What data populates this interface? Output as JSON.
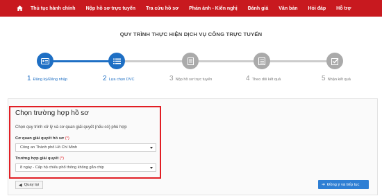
{
  "nav": {
    "items": [
      {
        "label": "Thủ tục hành chính"
      },
      {
        "label": "Nộp hồ sơ trực tuyến"
      },
      {
        "label": "Tra cứu hồ sơ"
      },
      {
        "label": "Phản ánh - Kiến nghị"
      },
      {
        "label": "Đánh giá"
      },
      {
        "label": "Văn bản"
      },
      {
        "label": "Hỏi đáp"
      },
      {
        "label": "Hỗ trợ"
      }
    ],
    "home_icon": "home-icon"
  },
  "page_title": "QUY TRÌNH THỰC HIỆN DỊCH VỤ CÔNG TRỰC TUYẾN",
  "steps": [
    {
      "num": "1",
      "label": "Đăng ký/Đăng nhập",
      "icon": "id-card-icon",
      "state": "done"
    },
    {
      "num": "2",
      "label": "Lựa chọn DVC",
      "icon": "list-icon",
      "state": "active"
    },
    {
      "num": "3",
      "label": "Nộp hồ sơ trực tuyến",
      "icon": "document-icon",
      "state": "todo"
    },
    {
      "num": "4",
      "label": "Theo dõi kết quả",
      "icon": "checklist-icon",
      "state": "todo"
    },
    {
      "num": "5",
      "label": "Nhận kết quả",
      "icon": "check-icon",
      "state": "todo"
    }
  ],
  "form": {
    "title": "Chọn trường hợp hồ sơ",
    "description": "Chọn quy trình xử lý và cơ quan giải quyết (nếu có) phù hợp",
    "agency_label": "Cơ quan giải quyết hồ sơ",
    "agency_required": "(*)",
    "agency_value": "Công an Thành phố Hồ Chí Minh",
    "case_label": "Trường hợp giải quyết",
    "case_required": "(*)",
    "case_value": "8 ngày - Cấp hộ chiếu phổ thông không gắn chip"
  },
  "buttons": {
    "back_label": "Quay lại",
    "next_label": "Đồng ý và tiếp tục"
  },
  "colors": {
    "brand_red": "#c8191f",
    "step_blue": "#1e6fc4",
    "button_blue": "#2f7fd4",
    "highlight_red": "#e11e24"
  }
}
